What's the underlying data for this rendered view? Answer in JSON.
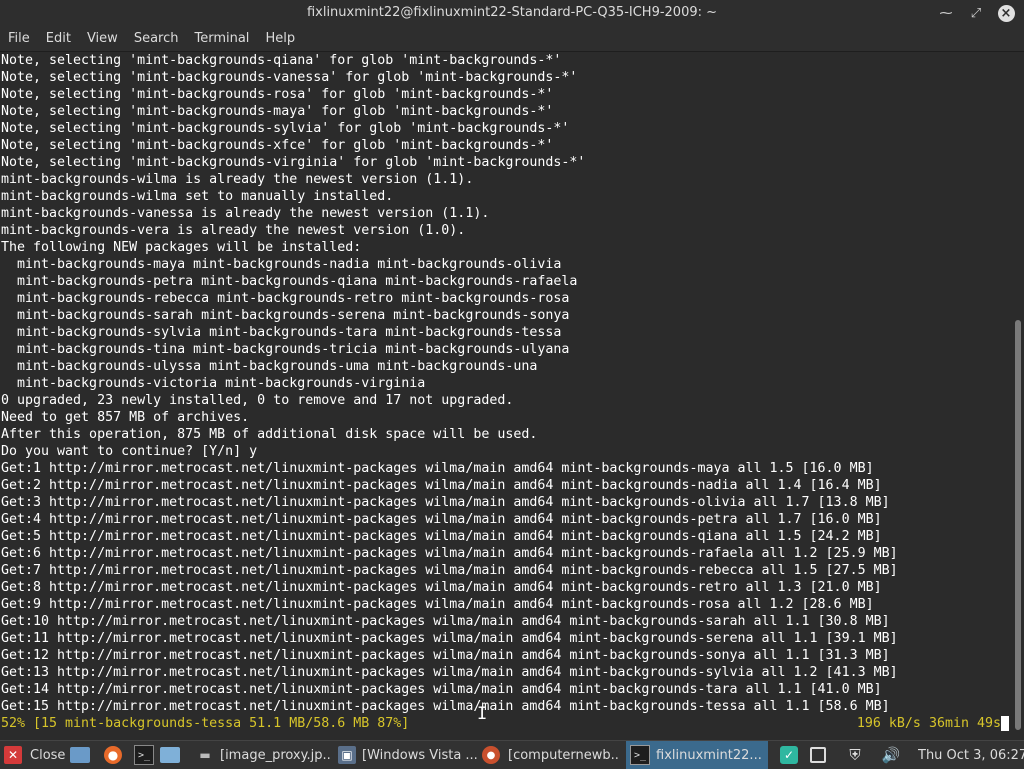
{
  "window": {
    "title": "fixlinuxmint22@fixlinuxmint22-Standard-PC-Q35-ICH9-2009: ~",
    "minimize": "⁓",
    "maximize": "⤢",
    "close": "×"
  },
  "menu": [
    "File",
    "Edit",
    "View",
    "Search",
    "Terminal",
    "Help"
  ],
  "terminal": {
    "lines": [
      "Note, selecting 'mint-backgrounds-qiana' for glob 'mint-backgrounds-*'",
      "Note, selecting 'mint-backgrounds-vanessa' for glob 'mint-backgrounds-*'",
      "Note, selecting 'mint-backgrounds-rosa' for glob 'mint-backgrounds-*'",
      "Note, selecting 'mint-backgrounds-maya' for glob 'mint-backgrounds-*'",
      "Note, selecting 'mint-backgrounds-sylvia' for glob 'mint-backgrounds-*'",
      "Note, selecting 'mint-backgrounds-xfce' for glob 'mint-backgrounds-*'",
      "Note, selecting 'mint-backgrounds-virginia' for glob 'mint-backgrounds-*'",
      "mint-backgrounds-wilma is already the newest version (1.1).",
      "mint-backgrounds-wilma set to manually installed.",
      "mint-backgrounds-vanessa is already the newest version (1.1).",
      "mint-backgrounds-vera is already the newest version (1.0).",
      "The following NEW packages will be installed:",
      "  mint-backgrounds-maya mint-backgrounds-nadia mint-backgrounds-olivia",
      "  mint-backgrounds-petra mint-backgrounds-qiana mint-backgrounds-rafaela",
      "  mint-backgrounds-rebecca mint-backgrounds-retro mint-backgrounds-rosa",
      "  mint-backgrounds-sarah mint-backgrounds-serena mint-backgrounds-sonya",
      "  mint-backgrounds-sylvia mint-backgrounds-tara mint-backgrounds-tessa",
      "  mint-backgrounds-tina mint-backgrounds-tricia mint-backgrounds-ulyana",
      "  mint-backgrounds-ulyssa mint-backgrounds-uma mint-backgrounds-una",
      "  mint-backgrounds-victoria mint-backgrounds-virginia",
      "0 upgraded, 23 newly installed, 0 to remove and 17 not upgraded.",
      "Need to get 857 MB of archives.",
      "After this operation, 875 MB of additional disk space will be used.",
      "Do you want to continue? [Y/n] y",
      "Get:1 http://mirror.metrocast.net/linuxmint-packages wilma/main amd64 mint-backgrounds-maya all 1.5 [16.0 MB]",
      "Get:2 http://mirror.metrocast.net/linuxmint-packages wilma/main amd64 mint-backgrounds-nadia all 1.4 [16.4 MB]",
      "Get:3 http://mirror.metrocast.net/linuxmint-packages wilma/main amd64 mint-backgrounds-olivia all 1.7 [13.8 MB]",
      "Get:4 http://mirror.metrocast.net/linuxmint-packages wilma/main amd64 mint-backgrounds-petra all 1.7 [16.0 MB]",
      "Get:5 http://mirror.metrocast.net/linuxmint-packages wilma/main amd64 mint-backgrounds-qiana all 1.5 [24.2 MB]",
      "Get:6 http://mirror.metrocast.net/linuxmint-packages wilma/main amd64 mint-backgrounds-rafaela all 1.2 [25.9 MB]",
      "Get:7 http://mirror.metrocast.net/linuxmint-packages wilma/main amd64 mint-backgrounds-rebecca all 1.5 [27.5 MB]",
      "Get:8 http://mirror.metrocast.net/linuxmint-packages wilma/main amd64 mint-backgrounds-retro all 1.3 [21.0 MB]",
      "Get:9 http://mirror.metrocast.net/linuxmint-packages wilma/main amd64 mint-backgrounds-rosa all 1.2 [28.6 MB]",
      "Get:10 http://mirror.metrocast.net/linuxmint-packages wilma/main amd64 mint-backgrounds-sarah all 1.1 [30.8 MB]",
      "Get:11 http://mirror.metrocast.net/linuxmint-packages wilma/main amd64 mint-backgrounds-serena all 1.1 [39.1 MB]",
      "Get:12 http://mirror.metrocast.net/linuxmint-packages wilma/main amd64 mint-backgrounds-sonya all 1.1 [31.3 MB]",
      "Get:13 http://mirror.metrocast.net/linuxmint-packages wilma/main amd64 mint-backgrounds-sylvia all 1.2 [41.3 MB]",
      "Get:14 http://mirror.metrocast.net/linuxmint-packages wilma/main amd64 mint-backgrounds-tara all 1.1 [41.0 MB]",
      "Get:15 http://mirror.metrocast.net/linuxmint-packages wilma/main amd64 mint-backgrounds-tessa all 1.1 [58.6 MB]"
    ],
    "status_left": "52% [15 mint-backgrounds-tessa 51.1 MB/58.6 MB 87%]",
    "status_right": "196 kB/s 36min 49s",
    "colors": {
      "background": "#2b2b2b",
      "text": "#ffffff",
      "progress": "#d7c52a"
    }
  },
  "scrollbar": {
    "position": 0.99
  },
  "panel": {
    "close_label": "Close",
    "tasks": [
      {
        "label": "[image_proxy.jp...",
        "icon": "image-viewer-icon"
      },
      {
        "label": "[Windows Vista ...",
        "icon": "vm-icon"
      },
      {
        "label": "[computernewb...",
        "icon": "browser-icon"
      },
      {
        "label": "fixlinuxmint22...",
        "icon": "terminal-icon"
      }
    ],
    "clock": "Thu Oct  3, 06:27",
    "accent": "#3b6a8d"
  }
}
